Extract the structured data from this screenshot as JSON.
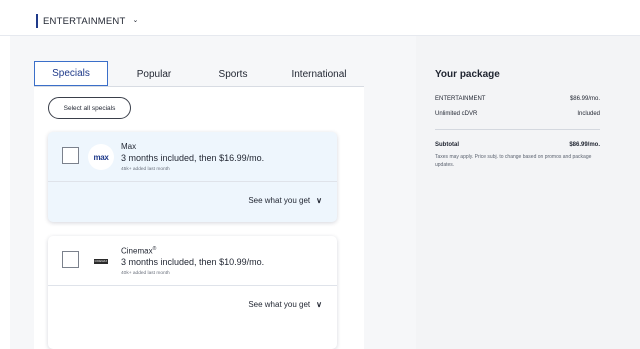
{
  "header": {
    "plan_label": "ENTERTAINMENT",
    "chevron_icon": "chevron-down-icon"
  },
  "tabs": [
    {
      "label": "Specials",
      "active": true
    },
    {
      "label": "Popular",
      "active": false
    },
    {
      "label": "Sports",
      "active": false
    },
    {
      "label": "International",
      "active": false
    }
  ],
  "select_all_label": "Select all specials",
  "channels": [
    {
      "name": "Max",
      "logo_text": "max",
      "price_text": "3 months included, then $16.99/mo.",
      "added_text": "45k+ added last month",
      "see_label": "See what you get",
      "selected_style": true
    },
    {
      "name": "Cinemax",
      "name_mark": "®",
      "logo_text": "CINEMAX",
      "price_text": "3 months included, then $10.99/mo.",
      "added_text": "40k+ added last month",
      "see_label": "See what you get",
      "selected_style": false
    }
  ],
  "package": {
    "title": "Your package",
    "lines": [
      {
        "label": "ENTERTAINMENT",
        "value": "$86.99/mo."
      },
      {
        "label": "Unlimited cDVR",
        "value": "Included"
      }
    ],
    "subtotal_label": "Subtotal",
    "subtotal_value": "$86.99/mo.",
    "taxes_note": "Taxes may apply. Price subj. to change based on promos and package updates."
  },
  "colors": {
    "accent": "#1f3a8a",
    "tab_border": "#3b6fc9",
    "selected_card_bg": "#eef6fd"
  }
}
